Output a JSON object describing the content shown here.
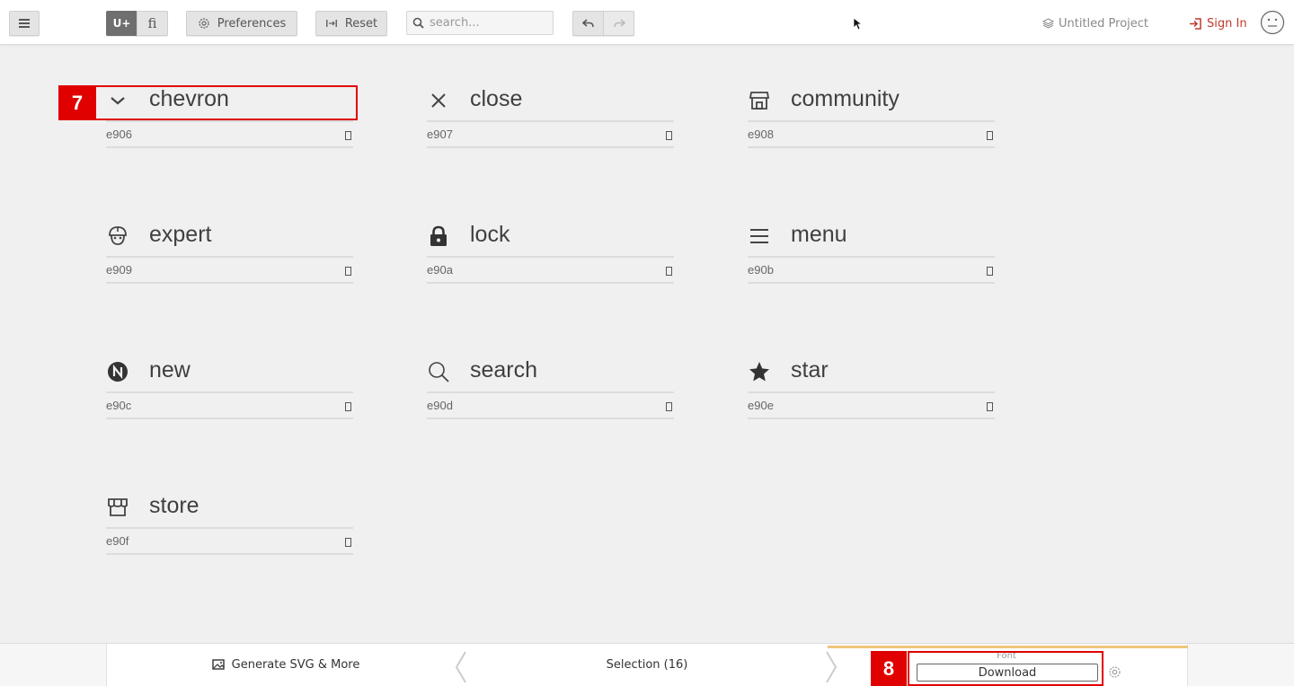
{
  "toolbar": {
    "menu_icon": "hamburger-icon",
    "mode_unicode": "U+",
    "mode_ligature": "fi",
    "preferences_label": "Preferences",
    "reset_label": "Reset",
    "search_placeholder": "search...",
    "project_name": "Untitled Project",
    "signin_label": "Sign In"
  },
  "glyphs": [
    {
      "name": "chevron",
      "code": "e906",
      "icon": "chevron-down-icon"
    },
    {
      "name": "close",
      "code": "e907",
      "icon": "close-icon"
    },
    {
      "name": "community",
      "code": "e908",
      "icon": "storefront-icon"
    },
    {
      "name": "expert",
      "code": "e909",
      "icon": "expert-icon"
    },
    {
      "name": "lock",
      "code": "e90a",
      "icon": "lock-icon"
    },
    {
      "name": "menu",
      "code": "e90b",
      "icon": "menu-icon"
    },
    {
      "name": "new",
      "code": "e90c",
      "icon": "new-badge-icon"
    },
    {
      "name": "search",
      "code": "e90d",
      "icon": "search-icon"
    },
    {
      "name": "star",
      "code": "e90e",
      "icon": "star-icon"
    },
    {
      "name": "store",
      "code": "e90f",
      "icon": "store-icon"
    }
  ],
  "annotations": {
    "tag_7": "7",
    "tag_8": "8"
  },
  "bottombar": {
    "generate_label": "Generate SVG & More",
    "selection_label": "Selection (16)",
    "font_label": "Font",
    "download_label": "Download"
  },
  "colors": {
    "accent_red": "#c0392b",
    "highlight_red": "#e00000",
    "font_tab_border": "#f0c57a"
  }
}
